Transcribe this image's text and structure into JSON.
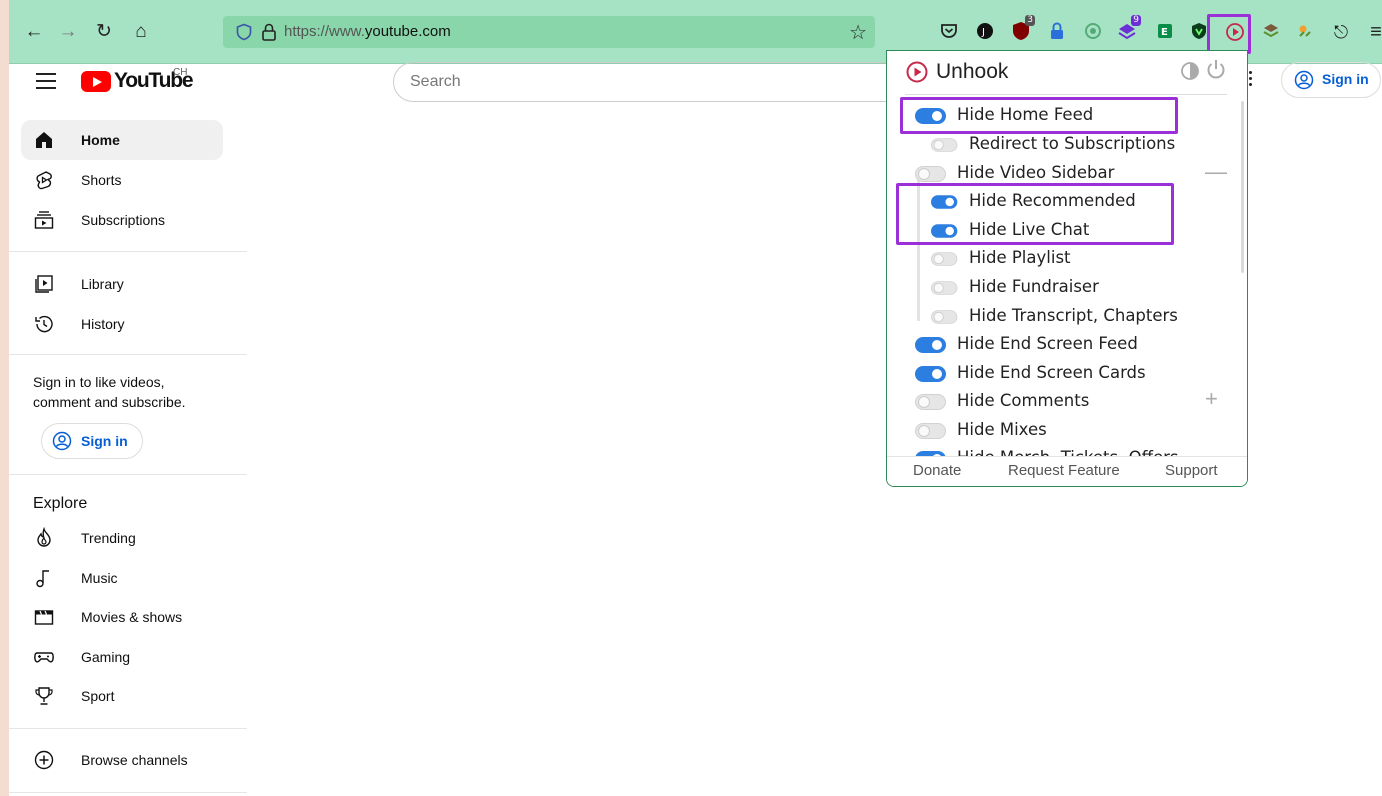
{
  "browser": {
    "back_icon": "←",
    "forward_icon": "→",
    "reload_icon": "↻",
    "home_icon": "⌂",
    "url_protocol": "https://www.",
    "url_host": "youtube.com",
    "bookmark_icon": "☆",
    "extensions_icon": "⎋",
    "menu_icon": "≡",
    "badges": {
      "ublock": "3",
      "ext_purple": "9"
    }
  },
  "youtube": {
    "logo_text": "YouTube",
    "logo_region": "CH",
    "search_placeholder": "Search",
    "signin_label": "Sign in",
    "nav_primary": [
      {
        "label": "Home",
        "icon": "home-icon"
      },
      {
        "label": "Shorts",
        "icon": "shorts-icon"
      },
      {
        "label": "Subscriptions",
        "icon": "subscriptions-icon"
      }
    ],
    "nav_secondary": [
      {
        "label": "Library",
        "icon": "library-icon"
      },
      {
        "label": "History",
        "icon": "history-icon"
      }
    ],
    "signin_prompt": "Sign in to like videos, comment and subscribe.",
    "explore_title": "Explore",
    "explore": [
      {
        "label": "Trending",
        "icon": "trending-icon"
      },
      {
        "label": "Music",
        "icon": "music-icon"
      },
      {
        "label": "Movies & shows",
        "icon": "movies-icon"
      },
      {
        "label": "Gaming",
        "icon": "gaming-icon"
      },
      {
        "label": "Sport",
        "icon": "sport-icon"
      }
    ],
    "browse_channels": "Browse channels"
  },
  "unhook": {
    "title": "Unhook",
    "options": [
      {
        "label": "Hide Home Feed",
        "on": true
      },
      {
        "label": "Redirect to Subscriptions",
        "on": false
      },
      {
        "label": "Hide Video Sidebar",
        "on": false
      },
      {
        "label": "Hide Recommended",
        "on": true
      },
      {
        "label": "Hide Live Chat",
        "on": true
      },
      {
        "label": "Hide Playlist",
        "on": false
      },
      {
        "label": "Hide Fundraiser",
        "on": false
      },
      {
        "label": "Hide Transcript, Chapters",
        "on": false
      },
      {
        "label": "Hide End Screen Feed",
        "on": true
      },
      {
        "label": "Hide End Screen Cards",
        "on": true
      },
      {
        "label": "Hide Comments",
        "on": false
      },
      {
        "label": "Hide Mixes",
        "on": false
      },
      {
        "label": "Hide Merch, Tickets, Offers",
        "on": true
      }
    ],
    "collapse_symbol": "—",
    "expand_symbol": "+",
    "footer": {
      "donate": "Donate",
      "request": "Request Feature",
      "support": "Support"
    }
  },
  "colors": {
    "toolbar": "#a6e3c4",
    "highlight": "#9b30d9",
    "toggle_on": "#2c7ee0",
    "youtube_red": "#ff0000",
    "unhook_red": "#c62a4b"
  }
}
